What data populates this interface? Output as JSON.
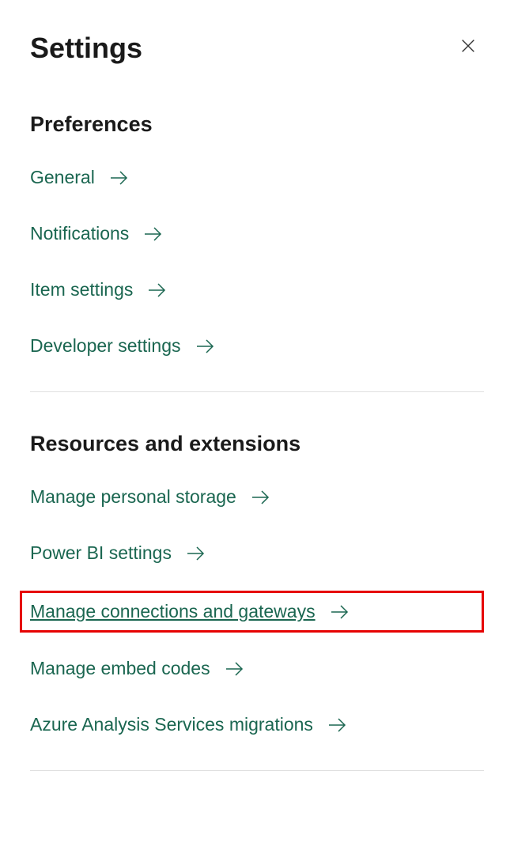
{
  "header": {
    "title": "Settings"
  },
  "sections": {
    "preferences": {
      "title": "Preferences",
      "items": [
        {
          "label": "General"
        },
        {
          "label": "Notifications"
        },
        {
          "label": "Item settings"
        },
        {
          "label": "Developer settings"
        }
      ]
    },
    "resources": {
      "title": "Resources and extensions",
      "items": [
        {
          "label": "Manage personal storage"
        },
        {
          "label": "Power BI settings"
        },
        {
          "label": "Manage connections and gateways"
        },
        {
          "label": "Manage embed codes"
        },
        {
          "label": "Azure Analysis Services migrations"
        }
      ]
    }
  }
}
